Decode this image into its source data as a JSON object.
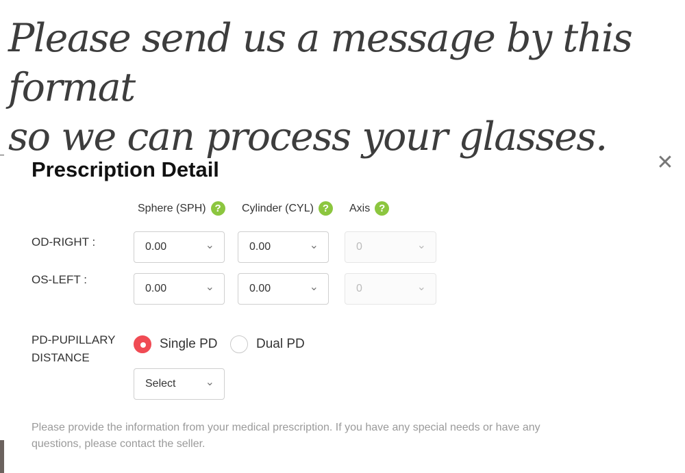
{
  "headline": {
    "line1": "Please send us a message by this format",
    "line2": "so we can process your glasses."
  },
  "modal": {
    "title": "Prescription Detail",
    "close_icon": "close-icon"
  },
  "columns": {
    "sphere": "Sphere (SPH)",
    "cylinder": "Cylinder (CYL)",
    "axis": "Axis",
    "help_glyph": "?"
  },
  "rows": {
    "od_label": "OD-RIGHT :",
    "os_label": "OS-LEFT :",
    "od": {
      "sphere": "0.00",
      "cylinder": "0.00",
      "axis": "0"
    },
    "os": {
      "sphere": "0.00",
      "cylinder": "0.00",
      "axis": "0"
    }
  },
  "pd": {
    "label_line1": "PD-PUPILLARY",
    "label_line2": "DISTANCE",
    "option_single": "Single PD",
    "option_dual": "Dual PD",
    "selected": "Single PD",
    "select_value": "Select"
  },
  "footnote": {
    "line1": "Please provide the information from your medical prescription. If you have any special needs or have any",
    "line2": "questions, please contact the seller."
  },
  "colors": {
    "accent_red": "#f04b54",
    "help_green": "#8cc63f"
  }
}
